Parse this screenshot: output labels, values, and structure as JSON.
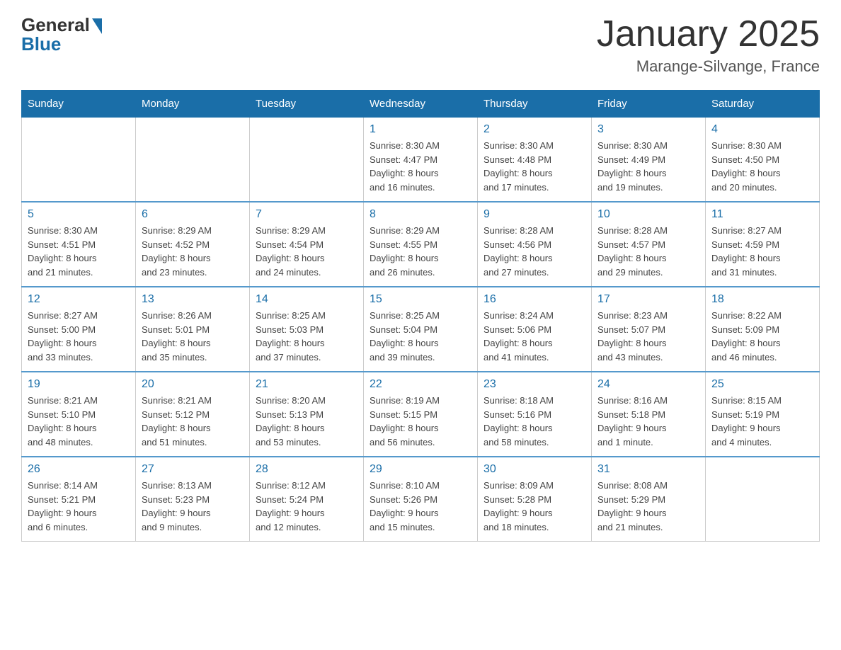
{
  "header": {
    "logo_general": "General",
    "logo_blue": "Blue",
    "title": "January 2025",
    "subtitle": "Marange-Silvange, France"
  },
  "days_of_week": [
    "Sunday",
    "Monday",
    "Tuesday",
    "Wednesday",
    "Thursday",
    "Friday",
    "Saturday"
  ],
  "weeks": [
    [
      {
        "day": "",
        "info": ""
      },
      {
        "day": "",
        "info": ""
      },
      {
        "day": "",
        "info": ""
      },
      {
        "day": "1",
        "info": "Sunrise: 8:30 AM\nSunset: 4:47 PM\nDaylight: 8 hours\nand 16 minutes."
      },
      {
        "day": "2",
        "info": "Sunrise: 8:30 AM\nSunset: 4:48 PM\nDaylight: 8 hours\nand 17 minutes."
      },
      {
        "day": "3",
        "info": "Sunrise: 8:30 AM\nSunset: 4:49 PM\nDaylight: 8 hours\nand 19 minutes."
      },
      {
        "day": "4",
        "info": "Sunrise: 8:30 AM\nSunset: 4:50 PM\nDaylight: 8 hours\nand 20 minutes."
      }
    ],
    [
      {
        "day": "5",
        "info": "Sunrise: 8:30 AM\nSunset: 4:51 PM\nDaylight: 8 hours\nand 21 minutes."
      },
      {
        "day": "6",
        "info": "Sunrise: 8:29 AM\nSunset: 4:52 PM\nDaylight: 8 hours\nand 23 minutes."
      },
      {
        "day": "7",
        "info": "Sunrise: 8:29 AM\nSunset: 4:54 PM\nDaylight: 8 hours\nand 24 minutes."
      },
      {
        "day": "8",
        "info": "Sunrise: 8:29 AM\nSunset: 4:55 PM\nDaylight: 8 hours\nand 26 minutes."
      },
      {
        "day": "9",
        "info": "Sunrise: 8:28 AM\nSunset: 4:56 PM\nDaylight: 8 hours\nand 27 minutes."
      },
      {
        "day": "10",
        "info": "Sunrise: 8:28 AM\nSunset: 4:57 PM\nDaylight: 8 hours\nand 29 minutes."
      },
      {
        "day": "11",
        "info": "Sunrise: 8:27 AM\nSunset: 4:59 PM\nDaylight: 8 hours\nand 31 minutes."
      }
    ],
    [
      {
        "day": "12",
        "info": "Sunrise: 8:27 AM\nSunset: 5:00 PM\nDaylight: 8 hours\nand 33 minutes."
      },
      {
        "day": "13",
        "info": "Sunrise: 8:26 AM\nSunset: 5:01 PM\nDaylight: 8 hours\nand 35 minutes."
      },
      {
        "day": "14",
        "info": "Sunrise: 8:25 AM\nSunset: 5:03 PM\nDaylight: 8 hours\nand 37 minutes."
      },
      {
        "day": "15",
        "info": "Sunrise: 8:25 AM\nSunset: 5:04 PM\nDaylight: 8 hours\nand 39 minutes."
      },
      {
        "day": "16",
        "info": "Sunrise: 8:24 AM\nSunset: 5:06 PM\nDaylight: 8 hours\nand 41 minutes."
      },
      {
        "day": "17",
        "info": "Sunrise: 8:23 AM\nSunset: 5:07 PM\nDaylight: 8 hours\nand 43 minutes."
      },
      {
        "day": "18",
        "info": "Sunrise: 8:22 AM\nSunset: 5:09 PM\nDaylight: 8 hours\nand 46 minutes."
      }
    ],
    [
      {
        "day": "19",
        "info": "Sunrise: 8:21 AM\nSunset: 5:10 PM\nDaylight: 8 hours\nand 48 minutes."
      },
      {
        "day": "20",
        "info": "Sunrise: 8:21 AM\nSunset: 5:12 PM\nDaylight: 8 hours\nand 51 minutes."
      },
      {
        "day": "21",
        "info": "Sunrise: 8:20 AM\nSunset: 5:13 PM\nDaylight: 8 hours\nand 53 minutes."
      },
      {
        "day": "22",
        "info": "Sunrise: 8:19 AM\nSunset: 5:15 PM\nDaylight: 8 hours\nand 56 minutes."
      },
      {
        "day": "23",
        "info": "Sunrise: 8:18 AM\nSunset: 5:16 PM\nDaylight: 8 hours\nand 58 minutes."
      },
      {
        "day": "24",
        "info": "Sunrise: 8:16 AM\nSunset: 5:18 PM\nDaylight: 9 hours\nand 1 minute."
      },
      {
        "day": "25",
        "info": "Sunrise: 8:15 AM\nSunset: 5:19 PM\nDaylight: 9 hours\nand 4 minutes."
      }
    ],
    [
      {
        "day": "26",
        "info": "Sunrise: 8:14 AM\nSunset: 5:21 PM\nDaylight: 9 hours\nand 6 minutes."
      },
      {
        "day": "27",
        "info": "Sunrise: 8:13 AM\nSunset: 5:23 PM\nDaylight: 9 hours\nand 9 minutes."
      },
      {
        "day": "28",
        "info": "Sunrise: 8:12 AM\nSunset: 5:24 PM\nDaylight: 9 hours\nand 12 minutes."
      },
      {
        "day": "29",
        "info": "Sunrise: 8:10 AM\nSunset: 5:26 PM\nDaylight: 9 hours\nand 15 minutes."
      },
      {
        "day": "30",
        "info": "Sunrise: 8:09 AM\nSunset: 5:28 PM\nDaylight: 9 hours\nand 18 minutes."
      },
      {
        "day": "31",
        "info": "Sunrise: 8:08 AM\nSunset: 5:29 PM\nDaylight: 9 hours\nand 21 minutes."
      },
      {
        "day": "",
        "info": ""
      }
    ]
  ]
}
